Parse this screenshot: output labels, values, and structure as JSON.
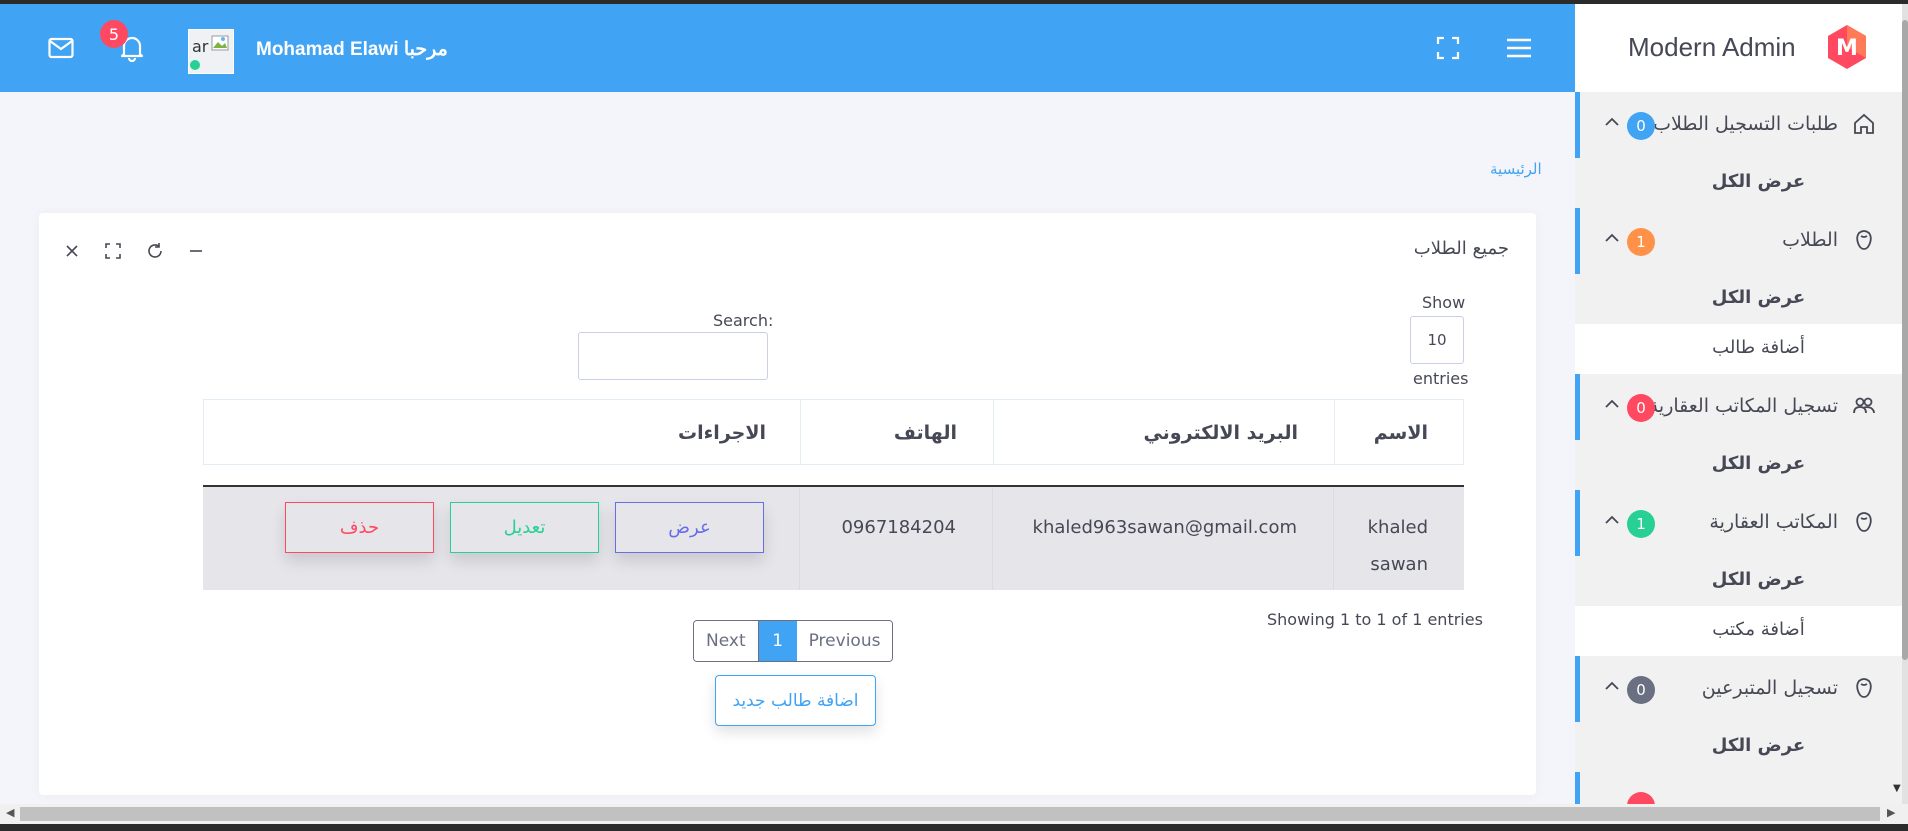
{
  "header": {
    "notification_count": "5",
    "avatar_alt": "ar",
    "welcome_text": "Mohamad Elawi مرحبا"
  },
  "sidebar": {
    "brand_title": "Modern Admin",
    "brand_logo_letter": "M",
    "menu": [
      {
        "label": "طلبات التسجيل الطلاب",
        "badge": "0",
        "badge_color": "#40a3f3",
        "icon": "home-icon",
        "subs": [
          {
            "label": "عرض الكل",
            "bold": true
          }
        ]
      },
      {
        "label": "الطلاب",
        "badge": "1",
        "badge_color": "#ff9149",
        "icon": "face-icon",
        "subs": [
          {
            "label": "عرض الكل",
            "bold": true
          },
          {
            "label": "أضافة طالب",
            "bold": false
          }
        ]
      },
      {
        "label": "تسجيل المكاتب العقارية",
        "badge": "0",
        "badge_color": "#ff4961",
        "icon": "users-icon",
        "subs": [
          {
            "label": "عرض الكل",
            "bold": true
          }
        ]
      },
      {
        "label": "المكاتب العقارية",
        "badge": "1",
        "badge_color": "#28d094",
        "icon": "face-icon",
        "subs": [
          {
            "label": "عرض الكل",
            "bold": true
          },
          {
            "label": "أضافة مكتب",
            "bold": false
          }
        ]
      },
      {
        "label": "تسجيل المتبرعين",
        "badge": "0",
        "badge_color": "#6b6f82",
        "icon": "face-icon",
        "subs": [
          {
            "label": "عرض الكل",
            "bold": true
          }
        ]
      }
    ]
  },
  "breadcrumb": {
    "home": "الرئيسية"
  },
  "card": {
    "title": "جميع الطلاب",
    "show_label": "Show",
    "show_value": "10",
    "entries_label": "entries",
    "search_label": "Search:",
    "search_value": "",
    "columns": {
      "name": "الاسم",
      "email": "البريد الالكتروني",
      "phone": "الهاتف",
      "actions": "الاجراءات"
    },
    "rows": [
      {
        "name_line1": "khaled",
        "name_line2": "sawan",
        "email": "khaled963sawan@gmail.com",
        "phone": "0967184204"
      }
    ],
    "actions": {
      "view": "عرض",
      "edit": "تعديل",
      "delete": "حذف"
    },
    "showing_text": "Showing 1 to 1 of 1 entries",
    "pagination": {
      "next": "Next",
      "current": "1",
      "previous": "Previous"
    },
    "add_button": "اضافة طالب جديد"
  },
  "colors": {
    "header": "#40a3f3",
    "accent": "#40a3f3",
    "danger": "#ff4961",
    "success": "#28d094",
    "primary": "#666ee8"
  }
}
